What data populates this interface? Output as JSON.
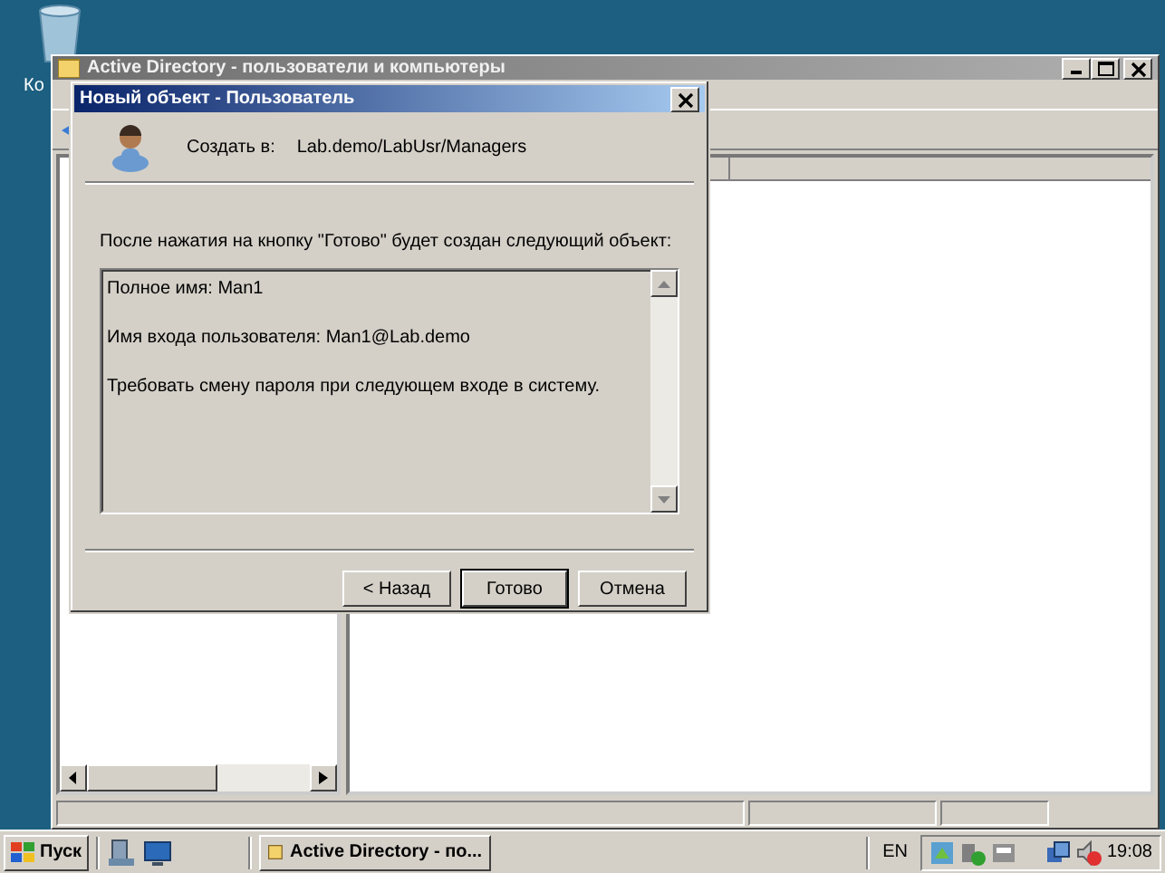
{
  "desktop": {
    "icons": [
      {
        "label": "Ко"
      }
    ]
  },
  "main_window": {
    "title": "Active Directory - пользователи и компьютеры",
    "active": false
  },
  "dialog": {
    "title": "Новый объект - Пользователь",
    "create_in_label": "Создать в:",
    "create_in_path": "Lab.demo/LabUsr/Managers",
    "intro": "После нажатия на кнопку \"Готово\" будет создан следующий объект:",
    "summary_lines": [
      "Полное имя: Man1",
      "Имя входа пользователя: Man1@Lab.demo",
      "Требовать смену пароля при следующем входе в систему."
    ],
    "buttons": [
      {
        "label": "< Назад",
        "default": false
      },
      {
        "label": "Готово",
        "default": true
      },
      {
        "label": "Отмена",
        "default": false
      }
    ]
  },
  "taskbar": {
    "start": "Пуск",
    "tasks": [
      {
        "label": "Active Directory - по...",
        "selected": false
      }
    ],
    "language": "EN",
    "clock": "19:08"
  }
}
